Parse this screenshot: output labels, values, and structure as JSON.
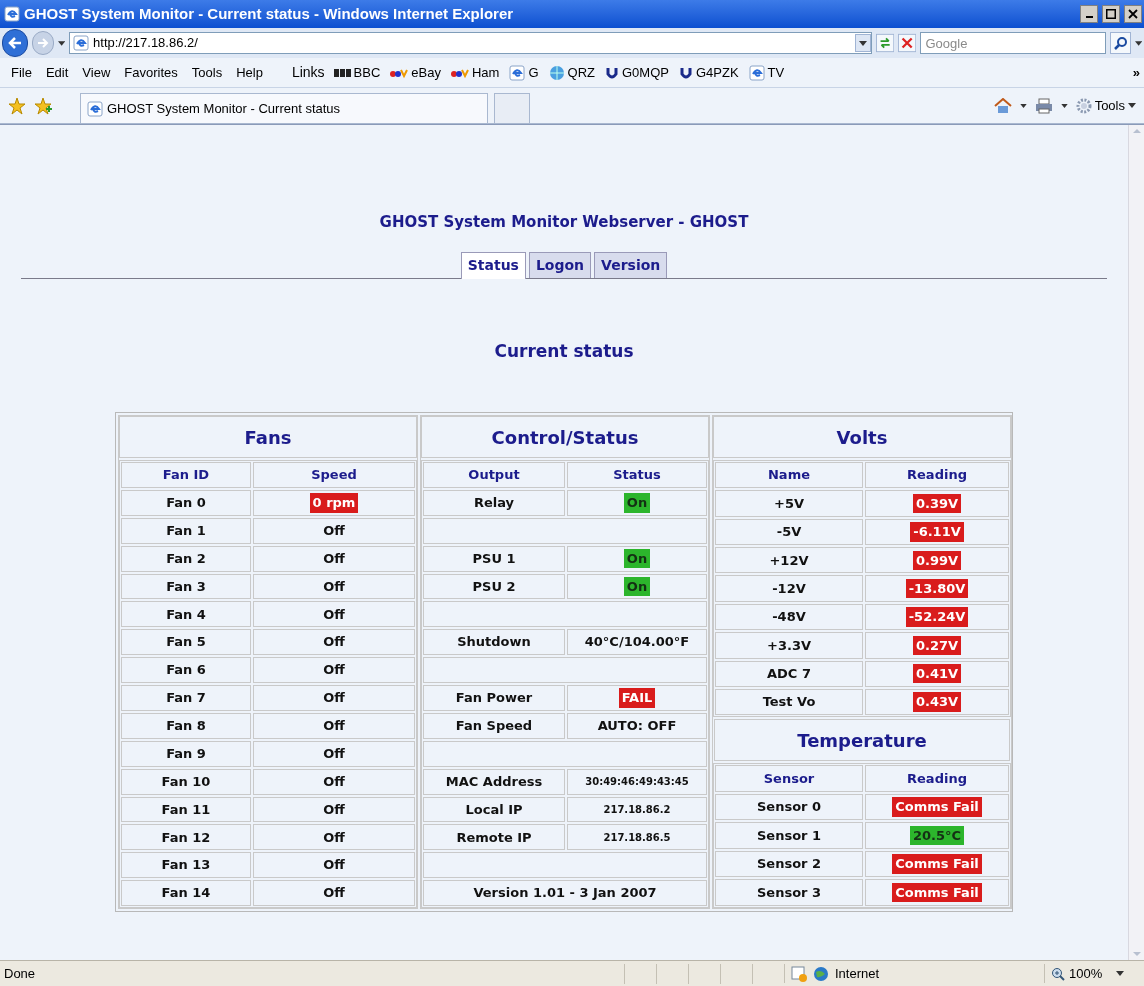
{
  "window": {
    "title": "GHOST System Monitor - Current status - Windows Internet Explorer"
  },
  "address_bar": {
    "url": "http://217.18.86.2/"
  },
  "search": {
    "placeholder": "Google"
  },
  "menu": [
    "File",
    "Edit",
    "View",
    "Favorites",
    "Tools",
    "Help"
  ],
  "links": {
    "label": "Links",
    "more": "»",
    "items": [
      {
        "label": "BBC",
        "kind": "bbc"
      },
      {
        "label": "eBay",
        "kind": "ebay"
      },
      {
        "label": "Ham",
        "kind": "ebay"
      },
      {
        "label": "G",
        "kind": "ie"
      },
      {
        "label": "QRZ",
        "kind": "globe"
      },
      {
        "label": "G0MQP",
        "kind": "u"
      },
      {
        "label": "G4PZK",
        "kind": "u"
      },
      {
        "label": "TV",
        "kind": "ie"
      }
    ]
  },
  "browser_tab": {
    "title": "GHOST System Monitor - Current status"
  },
  "command_bar": {
    "tools": "Tools"
  },
  "page": {
    "title": "GHOST System Monitor Webserver - GHOST",
    "tabs": [
      {
        "label": "Status",
        "selected": true
      },
      {
        "label": "Logon",
        "selected": false
      },
      {
        "label": "Version",
        "selected": false
      }
    ],
    "heading": "Current status",
    "fans": {
      "title": "Fans",
      "columns": [
        "Fan ID",
        "Speed"
      ],
      "rows": [
        {
          "id": "Fan 0",
          "speed": "0 rpm",
          "color": "#d91c1c"
        },
        {
          "id": "Fan 1",
          "speed": "Off"
        },
        {
          "id": "Fan 2",
          "speed": "Off"
        },
        {
          "id": "Fan 3",
          "speed": "Off"
        },
        {
          "id": "Fan 4",
          "speed": "Off"
        },
        {
          "id": "Fan 5",
          "speed": "Off"
        },
        {
          "id": "Fan 6",
          "speed": "Off"
        },
        {
          "id": "Fan 7",
          "speed": "Off"
        },
        {
          "id": "Fan 8",
          "speed": "Off"
        },
        {
          "id": "Fan 9",
          "speed": "Off"
        },
        {
          "id": "Fan 10",
          "speed": "Off"
        },
        {
          "id": "Fan 11",
          "speed": "Off"
        },
        {
          "id": "Fan 12",
          "speed": "Off"
        },
        {
          "id": "Fan 13",
          "speed": "Off"
        },
        {
          "id": "Fan 14",
          "speed": "Off"
        }
      ]
    },
    "control": {
      "title": "Control/Status",
      "columns": [
        "Output",
        "Status"
      ],
      "rows": [
        {
          "kind": "pair",
          "output": "Relay",
          "value": "On",
          "color": "#2cb52c"
        },
        {
          "kind": "blank"
        },
        {
          "kind": "pair",
          "output": "PSU 1",
          "value": "On",
          "color": "#2cb52c"
        },
        {
          "kind": "pair",
          "output": "PSU 2",
          "value": "On",
          "color": "#2cb52c"
        },
        {
          "kind": "blank"
        },
        {
          "kind": "pair",
          "output": "Shutdown",
          "value": "40°C/104.00°F"
        },
        {
          "kind": "blank"
        },
        {
          "kind": "pair",
          "output": "Fan Power",
          "value": "FAIL",
          "color": "#d91c1c"
        },
        {
          "kind": "pair",
          "output": "Fan Speed",
          "value": "AUTO: OFF"
        },
        {
          "kind": "blank"
        },
        {
          "kind": "address",
          "output": "MAC Address",
          "value": "30:49:46:49:43:45"
        },
        {
          "kind": "address",
          "output": "Local IP",
          "value": "217.18.86.2"
        },
        {
          "kind": "address",
          "output": "Remote IP",
          "value": "217.18.86.5"
        },
        {
          "kind": "blank"
        },
        {
          "kind": "full",
          "text": "Version 1.01 - 3 Jan 2007"
        }
      ]
    },
    "volts": {
      "title": "Volts",
      "columns": [
        "Name",
        "Reading"
      ],
      "rows": [
        {
          "name": "+5V",
          "reading": "0.39V",
          "color": "#d91c1c"
        },
        {
          "name": "-5V",
          "reading": "-6.11V",
          "color": "#d91c1c"
        },
        {
          "name": "+12V",
          "reading": "0.99V",
          "color": "#d91c1c"
        },
        {
          "name": "-12V",
          "reading": "-13.80V",
          "color": "#d91c1c"
        },
        {
          "name": "-48V",
          "reading": "-52.24V",
          "color": "#d91c1c"
        },
        {
          "name": "+3.3V",
          "reading": "0.27V",
          "color": "#d91c1c"
        },
        {
          "name": "ADC 7",
          "reading": "0.41V",
          "color": "#d91c1c"
        },
        {
          "name": "Test Vo",
          "reading": "0.43V",
          "color": "#d91c1c"
        }
      ]
    },
    "temperature": {
      "title": "Temperature",
      "columns": [
        "Sensor",
        "Reading"
      ],
      "rows": [
        {
          "name": "Sensor 0",
          "reading": "Comms Fail",
          "color": "#d91c1c"
        },
        {
          "name": "Sensor 1",
          "reading": "20.5°C",
          "color": "#2cb52c"
        },
        {
          "name": "Sensor 2",
          "reading": "Comms Fail",
          "color": "#d91c1c"
        },
        {
          "name": "Sensor 3",
          "reading": "Comms Fail",
          "color": "#d91c1c"
        }
      ]
    }
  },
  "status_bar": {
    "text": "Done",
    "zone": "Internet",
    "zoom": "100%"
  }
}
